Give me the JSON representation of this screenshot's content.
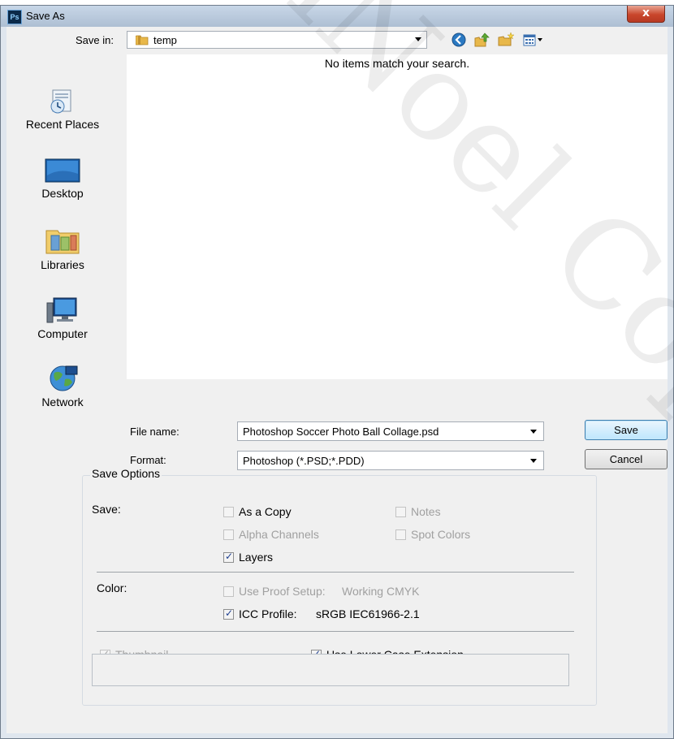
{
  "window": {
    "title": "Save As",
    "app_icon_text": "Ps",
    "close_label": "x"
  },
  "savein": {
    "label": "Save in:",
    "value": "temp"
  },
  "places": [
    "Recent Places",
    "Desktop",
    "Libraries",
    "Computer",
    "Network"
  ],
  "filelist": {
    "empty_message": "No items match your search."
  },
  "filename": {
    "label": "File name:",
    "value": "Photoshop Soccer Photo Ball Collage.psd"
  },
  "format": {
    "label": "Format:",
    "value": "Photoshop (*.PSD;*.PDD)"
  },
  "buttons": {
    "save": "Save",
    "cancel": "Cancel"
  },
  "options": {
    "group_title": "Save Options",
    "save_label": "Save:",
    "as_a_copy": "As a Copy",
    "notes": "Notes",
    "alpha_channels": "Alpha Channels",
    "spot_colors": "Spot Colors",
    "layers": "Layers",
    "color_label": "Color:",
    "use_proof_setup": "Use Proof Setup:",
    "proof_value": "Working CMYK",
    "icc_profile": "ICC Profile:",
    "icc_value": "sRGB IEC61966-2.1",
    "thumbnail": "Thumbnail",
    "lower_case_ext": "Use Lower Case Extension"
  },
  "checks": {
    "as_a_copy": false,
    "notes": false,
    "alpha_channels": false,
    "spot_colors": false,
    "layers": true,
    "use_proof_setup": false,
    "icc_profile": true,
    "thumbnail": true,
    "lower_case_ext": true
  },
  "watermark": "MaiNoel Copyright",
  "colors": {
    "accent": "#3c7fb1",
    "title_bar": "#aebfd3",
    "close": "#c9462c"
  }
}
